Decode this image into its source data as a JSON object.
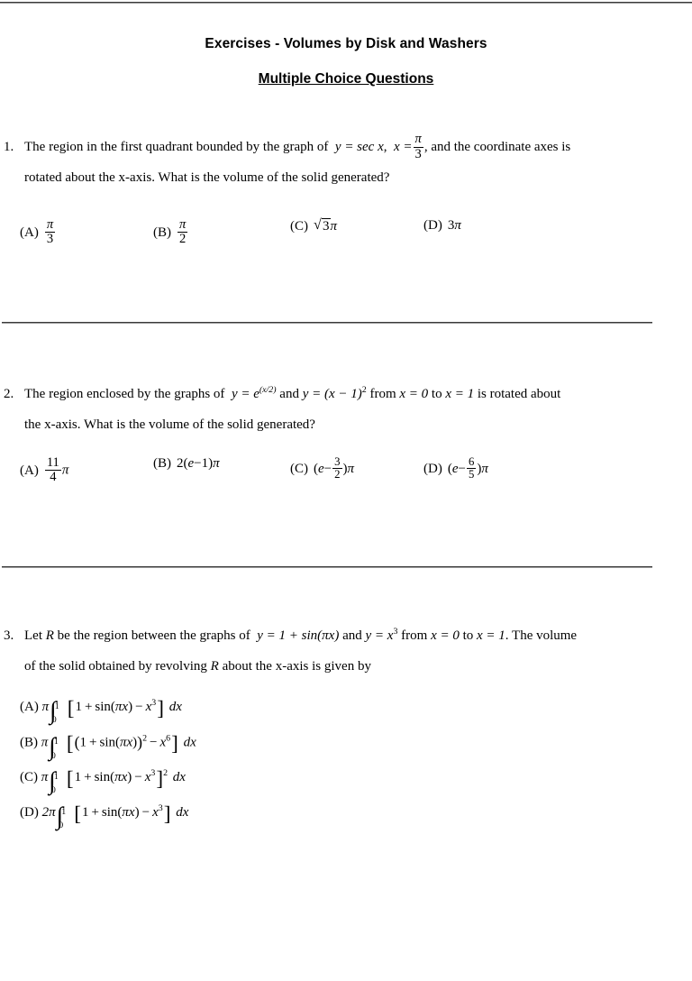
{
  "header": {
    "title": "Exercises - Volumes by Disk and Washers",
    "subtitle": "Multiple Choice Questions"
  },
  "questions": [
    {
      "number": "1.",
      "text_part1": "The region in the first quadrant bounded by the graph of",
      "expr_y": "y = sec x",
      "comma": ",",
      "expr_x_lead": "x =",
      "frac_num": "π",
      "frac_den": "3",
      "text_part2": ", and the coordinate axes is",
      "text_line2": "rotated about the x-axis. What is the volume of the solid generated?",
      "options": [
        {
          "tag": "(A)",
          "value": "π/3"
        },
        {
          "tag": "(B)",
          "value": "π/2"
        },
        {
          "tag": "(C)",
          "value": "√3π"
        },
        {
          "tag": "(D)",
          "value": "3π"
        }
      ]
    },
    {
      "number": "2.",
      "text_part1": "The region enclosed by the graphs of",
      "expr_y1_base": "y = e",
      "expr_y1_exp": "(x/2)",
      "and": "and",
      "expr_y2": "y = (x − 1)",
      "expr_y2_exp": "2",
      "from": "from",
      "x0": "x = 0",
      "to": "to",
      "x1": "x = 1",
      "tail": "is rotated about",
      "text_line2": "the x-axis. What is the volume of the solid generated?",
      "options": [
        {
          "tag": "(A)",
          "value": "11/4 π"
        },
        {
          "tag": "(B)",
          "value": "2(e − 1)π"
        },
        {
          "tag": "(C)",
          "value": "(e − 3/2)π"
        },
        {
          "tag": "(D)",
          "value": "(e − 6/5)π"
        }
      ]
    },
    {
      "number": "3.",
      "lead": "Let",
      "region": "R",
      "text_part1": "be the region between the graphs of",
      "expr_y1": "y = 1 + sin(πx)",
      "and": "and",
      "expr_y2_base": "y = x",
      "expr_y2_exp": "3",
      "from": "from",
      "x0": "x = 0",
      "to": "to",
      "x1": "x = 1",
      "tail": ". The volume",
      "line2_a": "of the solid obtained by revolving",
      "line2_region": "R",
      "line2_b": "about the x-axis is given by",
      "options": [
        {
          "tag": "(A)",
          "coef": "π",
          "lower": "0",
          "upper": "1",
          "integrand": "[1 + sin(πx) − x³]",
          "differential": "dx",
          "squared": false
        },
        {
          "tag": "(B)",
          "coef": "π",
          "lower": "0",
          "upper": "1",
          "integrand": "[(1 + sin(πx))² − x⁶]",
          "differential": "dx",
          "squared": false
        },
        {
          "tag": "(C)",
          "coef": "π",
          "lower": "0",
          "upper": "1",
          "integrand": "[1 + sin(πx) − x³]²",
          "differential": "dx",
          "squared": true
        },
        {
          "tag": "(D)",
          "coef": "2π",
          "lower": "0",
          "upper": "1",
          "integrand": "[1 + sin(πx) − x³]",
          "differential": "dx",
          "squared": false
        }
      ]
    }
  ],
  "math_tokens": {
    "pi": "π",
    "integral": "∫",
    "minus": "−",
    "bracket_left": "[",
    "bracket_right": "]",
    "paren_left": "(",
    "paren_right": ")",
    "equals": "=",
    "plus": "+",
    "dx": "dx",
    "sec": "sec",
    "sin": "sin",
    "e": "e",
    "x": "x",
    "y": "y",
    "R": "R",
    "one": "1",
    "two": "2",
    "three": "3",
    "four": "4",
    "five": "5",
    "six": "6",
    "eleven": "11",
    "zero": "0",
    "exp_x_over_2": "(x/2)"
  }
}
